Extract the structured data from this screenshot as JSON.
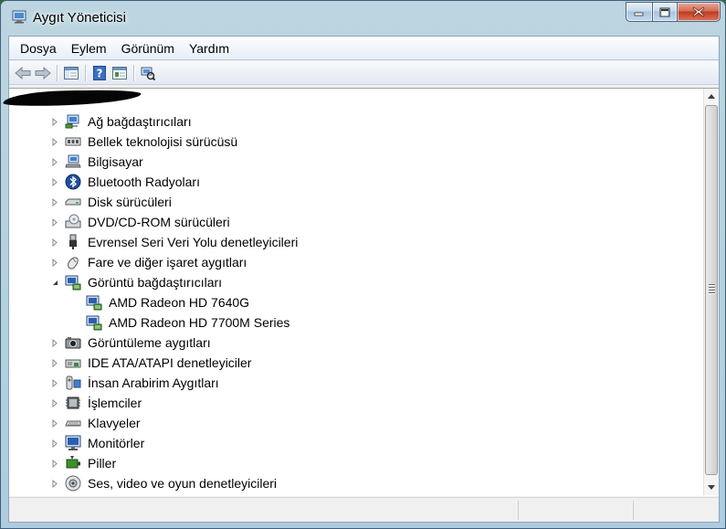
{
  "window": {
    "title": "Aygıt Yöneticisi"
  },
  "menu": {
    "items": [
      "Dosya",
      "Eylem",
      "Görünüm",
      "Yardım"
    ]
  },
  "toolbar": {
    "icons": [
      "back-arrow-icon",
      "forward-arrow-icon",
      "show-hide-tree-icon",
      "help-icon",
      "properties-icon",
      "scan-hardware-icon"
    ]
  },
  "tree": {
    "items": [
      {
        "label": "Ağ bağdaştırıcıları",
        "icon": "network-adapter-icon",
        "level": 0,
        "expanded": false
      },
      {
        "label": "Bellek teknolojisi sürücüsü",
        "icon": "memory-technology-icon",
        "level": 0,
        "expanded": false
      },
      {
        "label": "Bilgisayar",
        "icon": "computer-icon",
        "level": 0,
        "expanded": false
      },
      {
        "label": "Bluetooth Radyoları",
        "icon": "bluetooth-icon",
        "level": 0,
        "expanded": false
      },
      {
        "label": "Disk sürücüleri",
        "icon": "disk-drive-icon",
        "level": 0,
        "expanded": false
      },
      {
        "label": "DVD/CD-ROM sürücüleri",
        "icon": "dvd-drive-icon",
        "level": 0,
        "expanded": false
      },
      {
        "label": "Evrensel Seri Veri Yolu denetleyicileri",
        "icon": "usb-icon",
        "level": 0,
        "expanded": false
      },
      {
        "label": "Fare ve diğer işaret aygıtları",
        "icon": "mouse-icon",
        "level": 0,
        "expanded": false
      },
      {
        "label": "Görüntü bağdaştırıcıları",
        "icon": "display-adapter-icon",
        "level": 0,
        "expanded": true
      },
      {
        "label": "AMD Radeon HD 7640G",
        "icon": "display-adapter-icon",
        "level": 1,
        "expanded": null
      },
      {
        "label": "AMD Radeon HD 7700M Series",
        "icon": "display-adapter-icon",
        "level": 1,
        "expanded": null
      },
      {
        "label": "Görüntüleme aygıtları",
        "icon": "imaging-device-icon",
        "level": 0,
        "expanded": false
      },
      {
        "label": "IDE ATA/ATAPI denetleyiciler",
        "icon": "ide-controller-icon",
        "level": 0,
        "expanded": false
      },
      {
        "label": "İnsan Arabirim Aygıtları",
        "icon": "hid-icon",
        "level": 0,
        "expanded": false
      },
      {
        "label": "İşlemciler",
        "icon": "processor-icon",
        "level": 0,
        "expanded": false
      },
      {
        "label": "Klavyeler",
        "icon": "keyboard-icon",
        "level": 0,
        "expanded": false
      },
      {
        "label": "Monitörler",
        "icon": "monitor-icon",
        "level": 0,
        "expanded": false
      },
      {
        "label": "Piller",
        "icon": "battery-icon",
        "level": 0,
        "expanded": false
      },
      {
        "label": "Ses, video ve oyun denetleyicileri",
        "icon": "sound-icon",
        "level": 0,
        "expanded": false
      }
    ]
  },
  "colors": {
    "accent": "#3e5e7c",
    "close_button": "#c0391d"
  }
}
